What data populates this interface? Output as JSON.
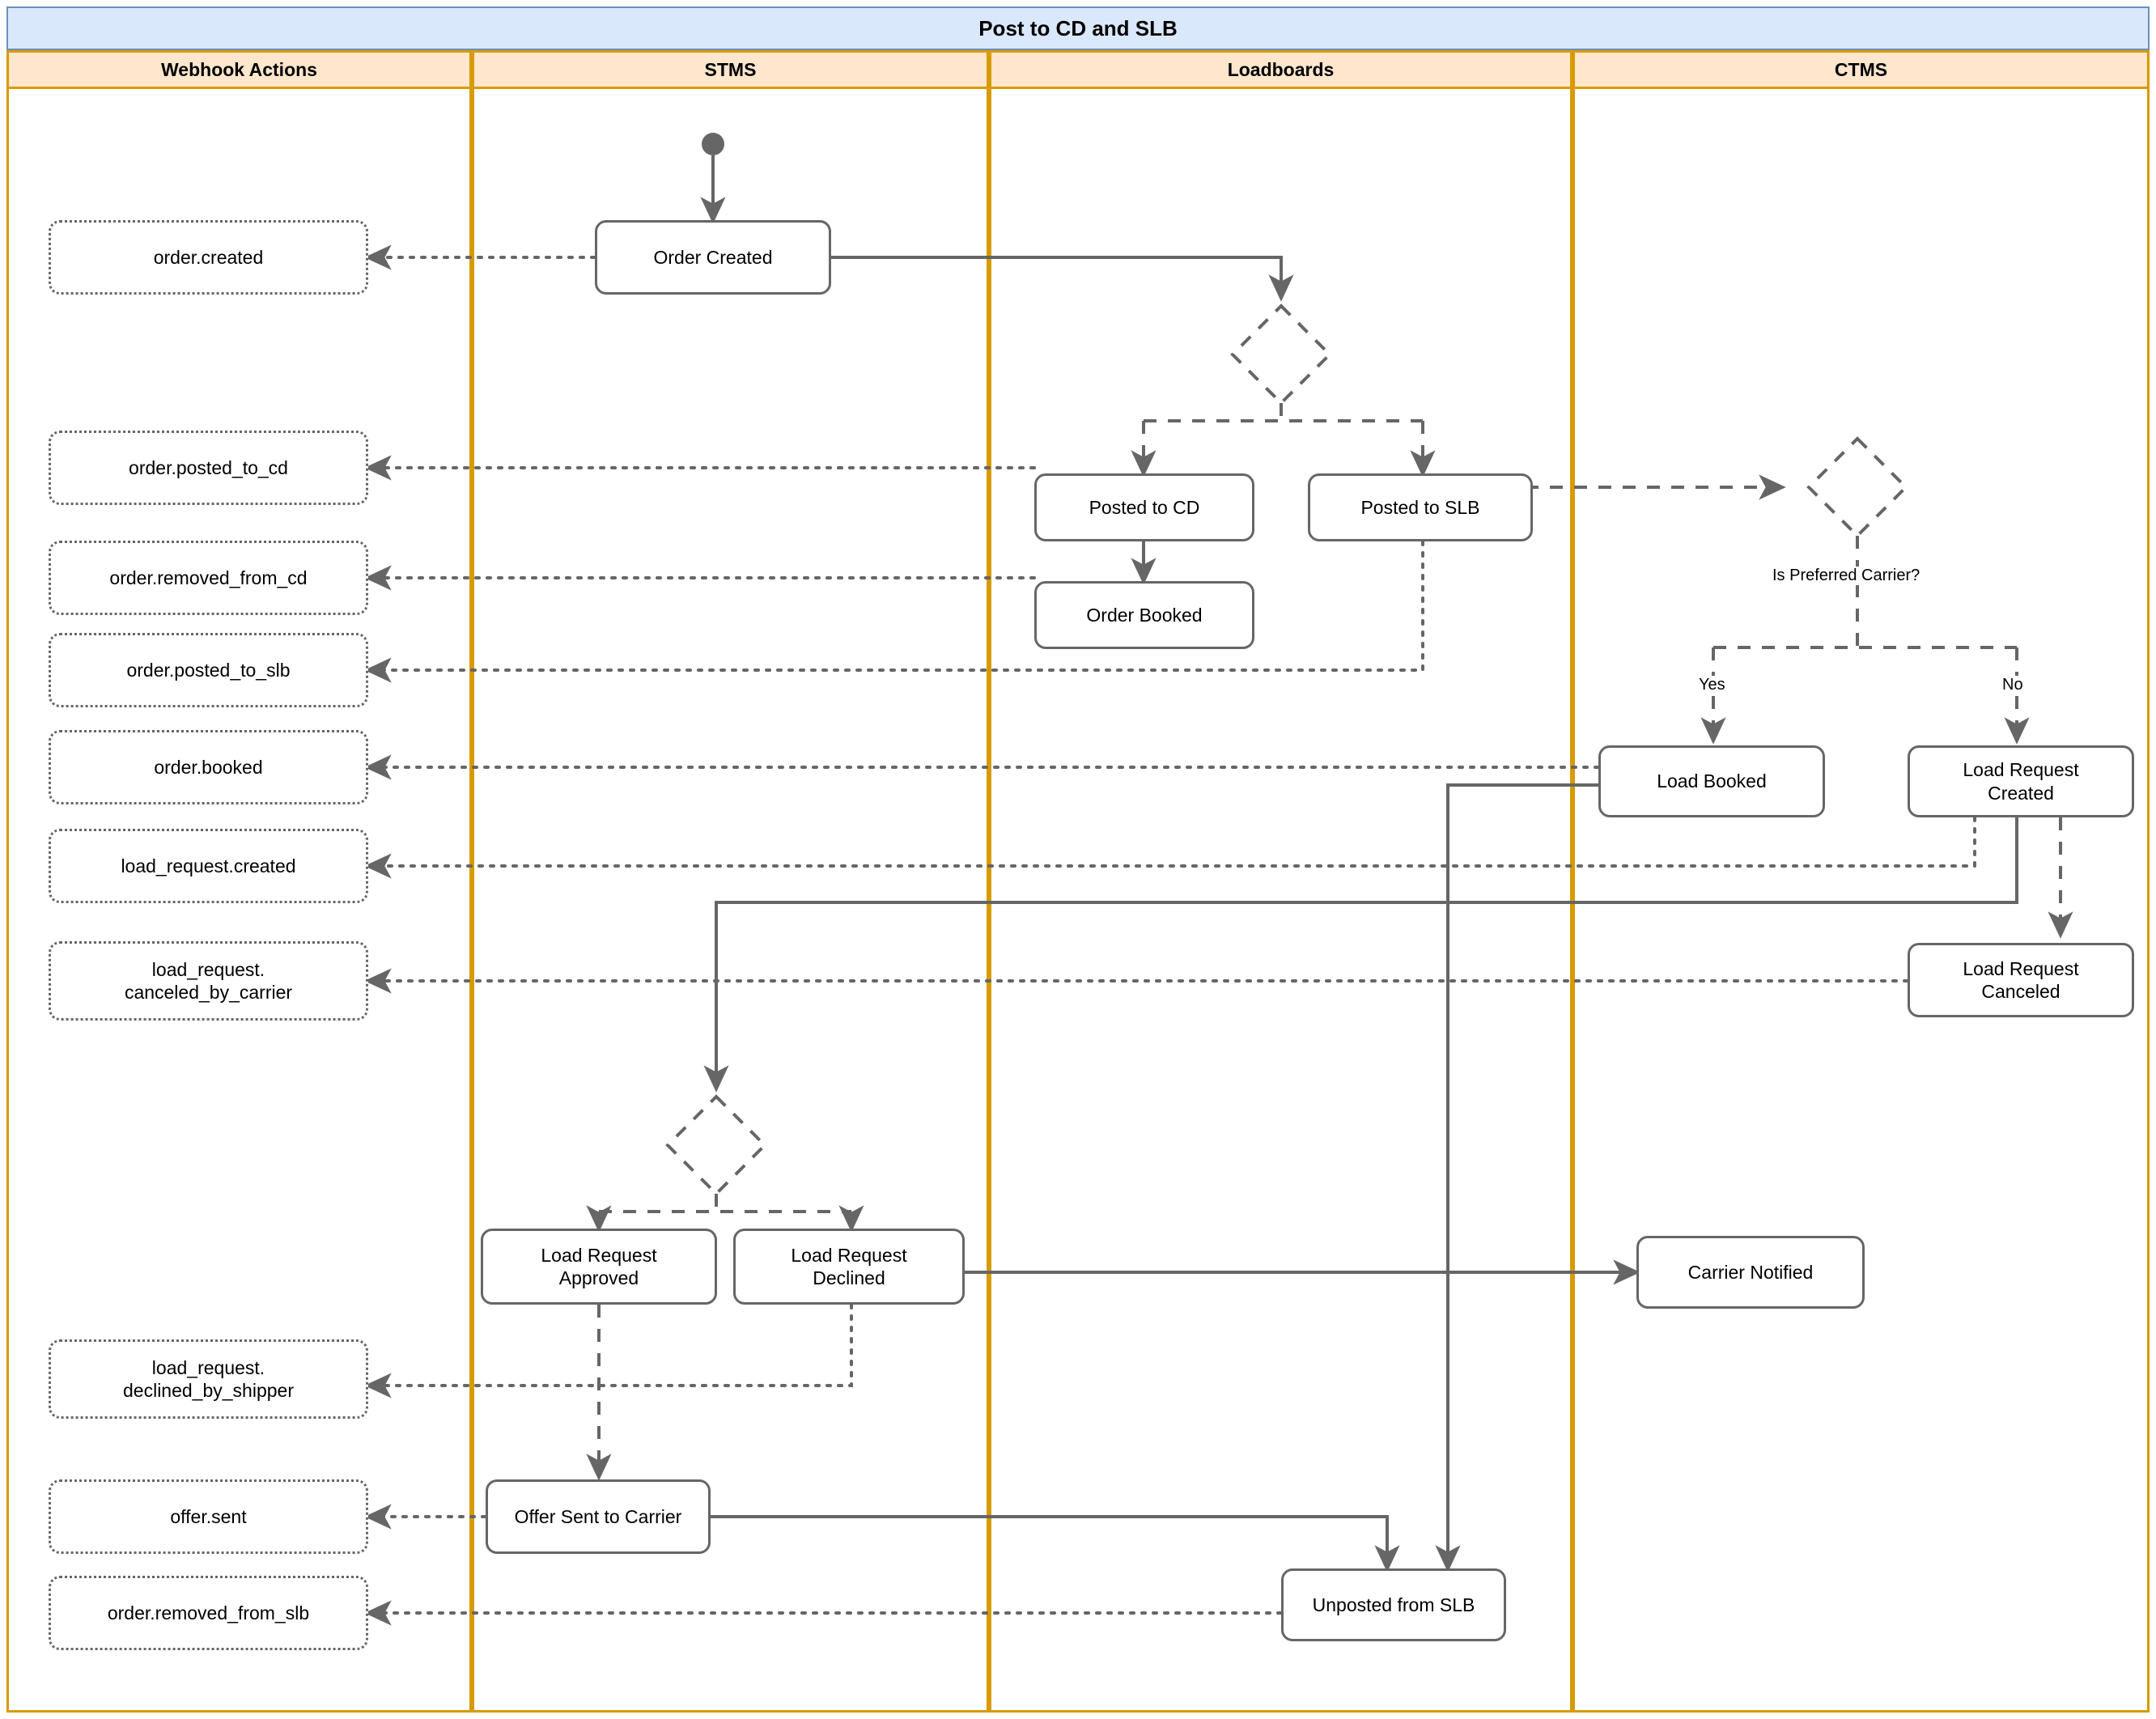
{
  "diagram": {
    "title": "Post to CD and SLB",
    "type": "swimlane-state-diagram",
    "colors": {
      "title_fill": "#dae8fc",
      "title_stroke": "#6c8ebf",
      "lane_header_fill": "#ffe6cc",
      "lane_stroke": "#d79b00",
      "node_stroke": "#666666",
      "edge_stroke": "#666666"
    }
  },
  "lanes": [
    {
      "id": "webhook",
      "label": "Webhook Actions"
    },
    {
      "id": "stms",
      "label": "STMS"
    },
    {
      "id": "loadboards",
      "label": "Loadboards"
    },
    {
      "id": "ctms",
      "label": "CTMS"
    }
  ],
  "nodes": {
    "order_created": "Order Created",
    "posted_to_cd": "Posted to CD",
    "posted_to_slb": "Posted to SLB",
    "order_booked": "Order Booked",
    "load_booked": "Load Booked",
    "load_request_created": "Load Request\nCreated",
    "load_request_created_l1": "Load Request",
    "load_request_created_l2": "Created",
    "load_request_canceled_l1": "Load Request",
    "load_request_canceled_l2": "Canceled",
    "load_request_approved_l1": "Load Request",
    "load_request_approved_l2": "Approved",
    "load_request_declined_l1": "Load Request",
    "load_request_declined_l2": "Declined",
    "carrier_notified": "Carrier Notified",
    "offer_sent_to_carrier": "Offer Sent to Carrier",
    "unposted_from_slb": "Unposted from SLB"
  },
  "webhooks": [
    {
      "id": "order_created",
      "label": "order.created"
    },
    {
      "id": "order_posted_to_cd",
      "label": "order.posted_to_cd"
    },
    {
      "id": "order_removed_from_cd",
      "label": "order.removed_from_cd"
    },
    {
      "id": "order_posted_to_slb",
      "label": "order.posted_to_slb"
    },
    {
      "id": "order_booked",
      "label": "order.booked"
    },
    {
      "id": "load_request_created",
      "label": "load_request.created"
    },
    {
      "id": "load_request_canceled_by_carrier",
      "line1": "load_request.",
      "line2": "canceled_by_carrier"
    },
    {
      "id": "load_request_declined_by_shipper",
      "line1": "load_request.",
      "line2": "declined_by_shipper"
    },
    {
      "id": "offer_sent",
      "label": "offer.sent"
    },
    {
      "id": "order_removed_from_slb",
      "label": "order.removed_from_slb"
    }
  ],
  "edge_labels": {
    "is_preferred_carrier": "Is Preferred Carrier?",
    "yes": "Yes",
    "no": "No"
  }
}
